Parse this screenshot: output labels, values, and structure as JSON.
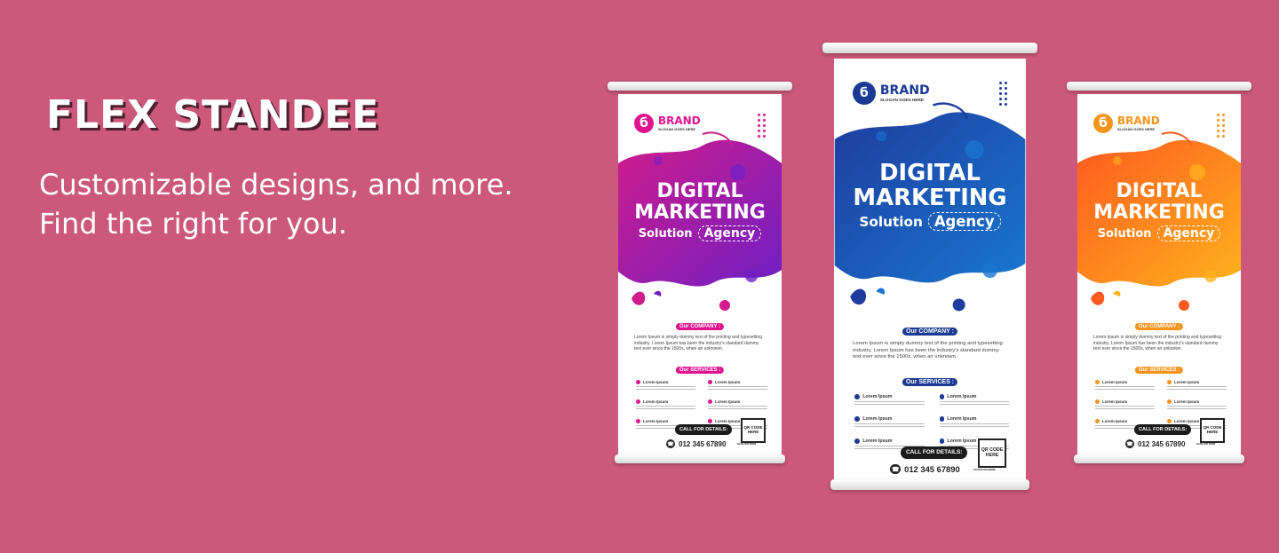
{
  "hero": {
    "title": "FLEX STANDEE",
    "subtitle_line1": "Customizable designs, and more.",
    "subtitle_line2": "Find the right for you."
  },
  "banner_text": {
    "brand_name": "BRAND",
    "brand_slogan": "SLOGAN GOES HERE",
    "headline_line1": "DIGITAL",
    "headline_line2": "MARKETING",
    "solution": "Solution",
    "agency": "Agency",
    "company_heading": "Our COMPANY :",
    "company_body": "Lorem Ipsum is simply dummy text of the printing and typesetting industry. Lorem Ipsum has been the industry's standard dummy text ever since the 1500s, when an unknown.",
    "services_heading": "Our SERVICES :",
    "service_label": "Lorem Ipsum",
    "call_label": "CALL FOR DETAILS:",
    "phone": "012 345 67890",
    "qr_text": "QR CODE HERE",
    "qr_caption": "SCAN FOR MORE"
  },
  "standees": [
    {
      "name": "purple",
      "primary": "#d01c8b",
      "secondary": "#6f1fc4",
      "accent": "#e0148f"
    },
    {
      "name": "blue",
      "primary": "#1f3c9e",
      "secondary": "#1877d0",
      "accent": "#1a3a94"
    },
    {
      "name": "orange",
      "primary": "#ff5a1f",
      "secondary": "#ffb21e",
      "accent": "#f7941d"
    }
  ]
}
